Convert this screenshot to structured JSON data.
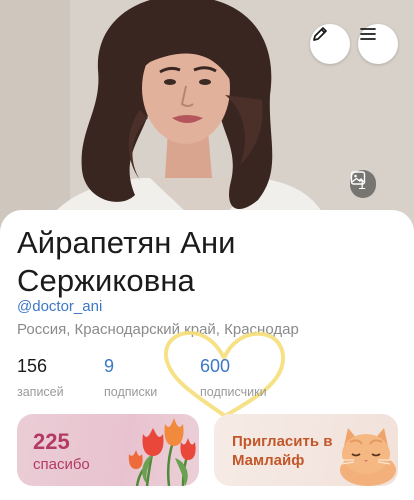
{
  "profile": {
    "photo_count": "1",
    "name": "Айрапетян Ани Сержиковна",
    "handle": "@doctor_ani",
    "location": "Россия, Краснодарский край, Краснодар"
  },
  "stats": [
    {
      "value": "156",
      "label": "записей"
    },
    {
      "value": "9",
      "label": "подписки"
    },
    {
      "value": "600",
      "label": "подписчики"
    }
  ],
  "thanks_tile": {
    "count": "225",
    "label": "спасибо"
  },
  "invite_tile": {
    "label": "Пригласить в Мамлайф"
  },
  "icons": {
    "edit": "pencil-icon",
    "menu": "hamburger-menu-icon",
    "photos": "image-icon",
    "flowers": "tulips-illustration",
    "cat": "cat-illustration",
    "heart": "heart-doodle"
  },
  "colors": {
    "accent_blue": "#3d78c7",
    "thanks_pink": "#b33a63",
    "invite_orange": "#c2572a",
    "heart_yellow": "#f6de7a"
  }
}
